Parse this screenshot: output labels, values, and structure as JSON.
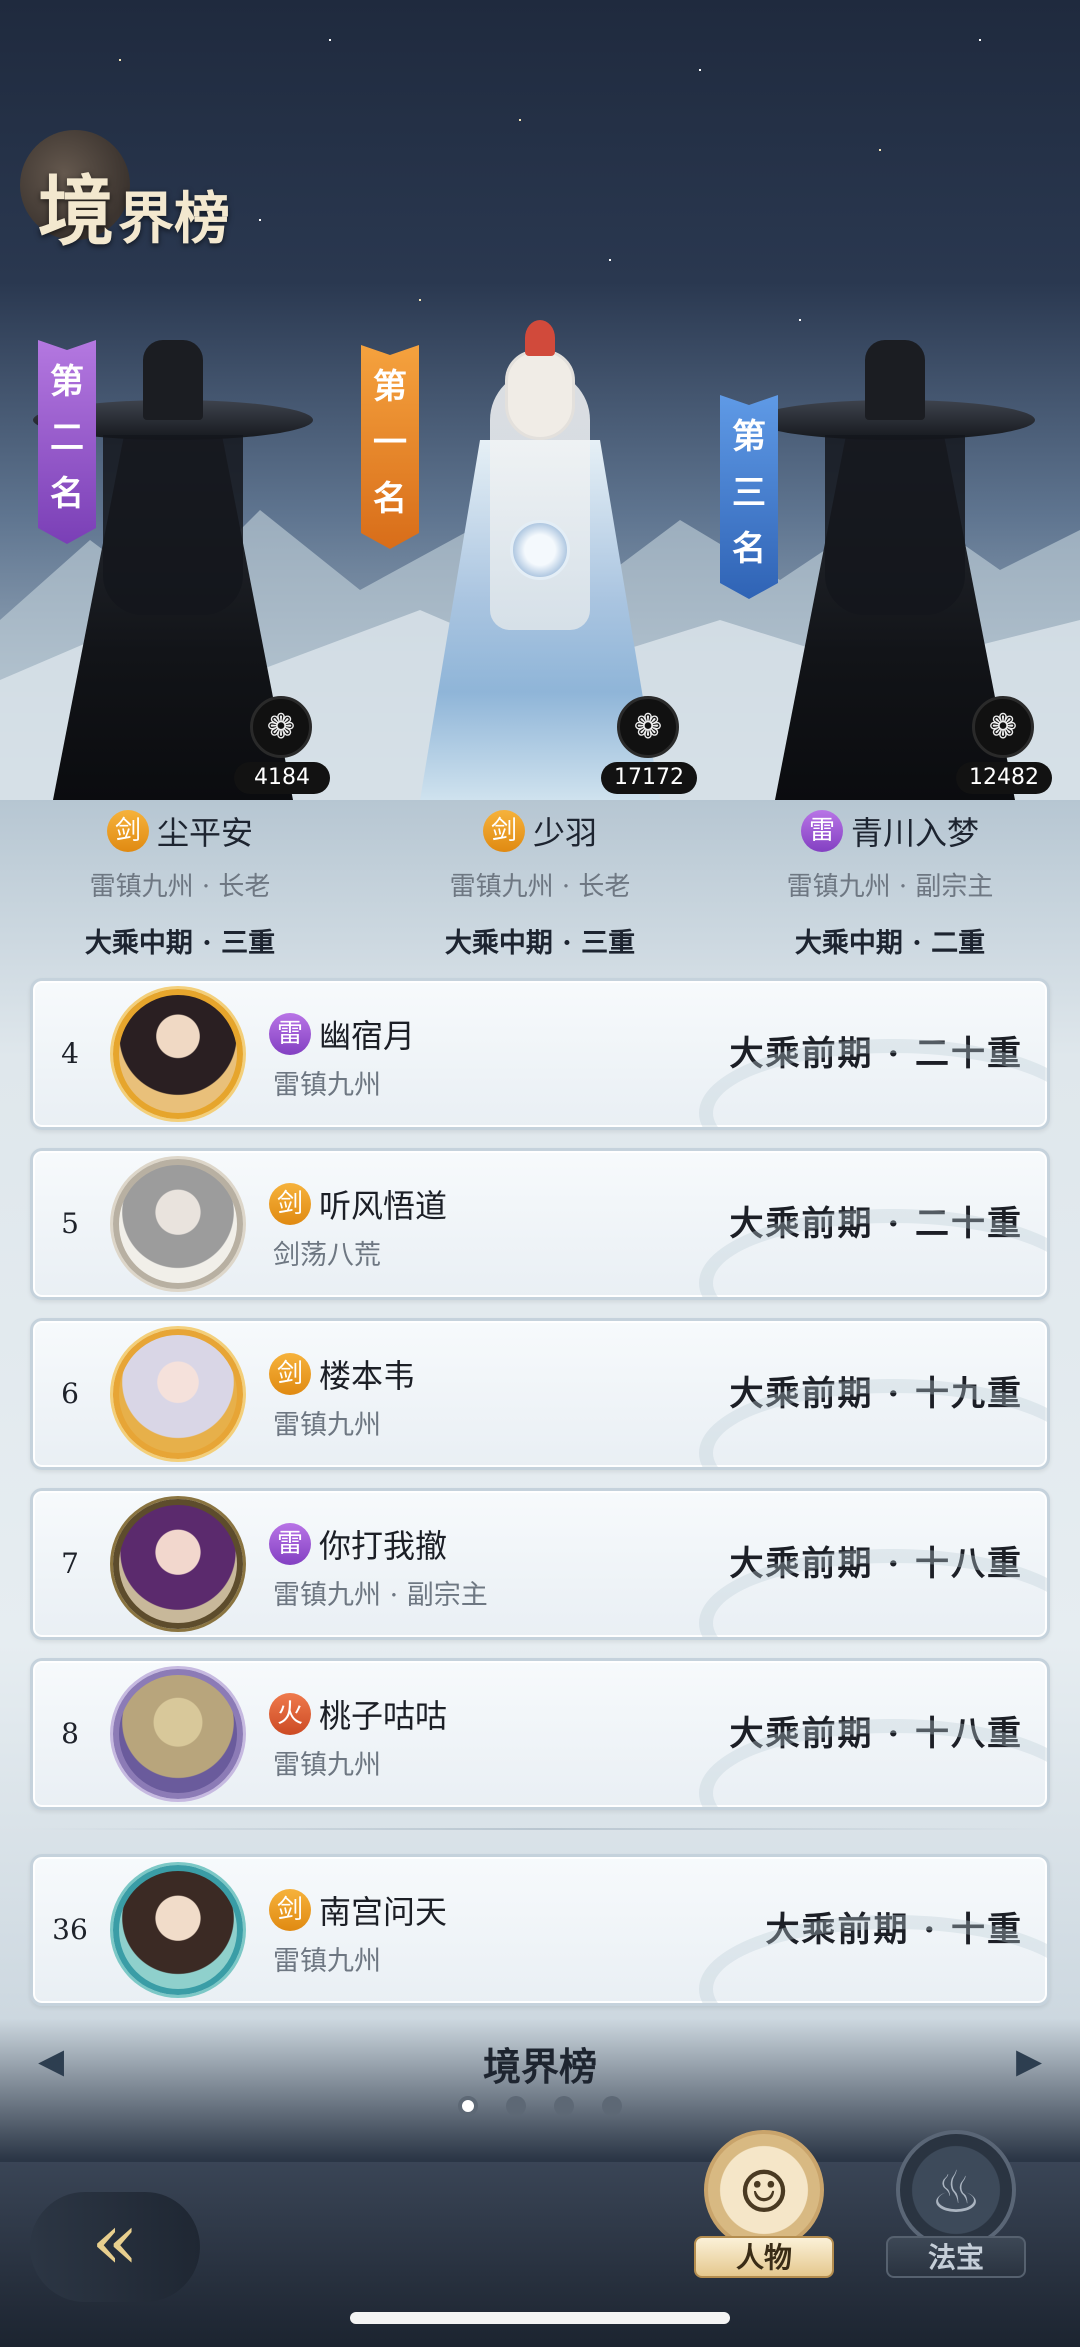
{
  "header": {
    "title_big": "境",
    "title_small": "界榜"
  },
  "podium": [
    {
      "rank_label": [
        "第",
        "二",
        "名"
      ],
      "badge": "剑",
      "badge_type": "sword",
      "name": "尘平安",
      "sect": "雷镇九州 · 长老",
      "realm": "大乘中期 · 三重",
      "likes": "4184"
    },
    {
      "rank_label": [
        "第",
        "一",
        "名"
      ],
      "badge": "剑",
      "badge_type": "sword",
      "name": "少羽",
      "sect": "雷镇九州 · 长老",
      "realm": "大乘中期 · 三重",
      "likes": "17172"
    },
    {
      "rank_label": [
        "第",
        "三",
        "名"
      ],
      "badge": "雷",
      "badge_type": "thunder",
      "name": "青川入梦",
      "sect": "雷镇九州 · 副宗主",
      "realm": "大乘中期 · 二重",
      "likes": "12482"
    }
  ],
  "ranking_list": [
    {
      "rank": "4",
      "badge": "雷",
      "badge_type": "thunder",
      "name": "幽宿月",
      "sect": "雷镇九州",
      "realm": "大乘前期 · 二十重"
    },
    {
      "rank": "5",
      "badge": "剑",
      "badge_type": "sword",
      "name": "听风悟道",
      "sect": "剑荡八荒",
      "realm": "大乘前期 · 二十重"
    },
    {
      "rank": "6",
      "badge": "剑",
      "badge_type": "sword",
      "name": "楼本韦",
      "sect": "雷镇九州",
      "realm": "大乘前期 · 十九重"
    },
    {
      "rank": "7",
      "badge": "雷",
      "badge_type": "thunder",
      "name": "你打我撤",
      "sect": "雷镇九州 · 副宗主",
      "realm": "大乘前期 · 十八重"
    },
    {
      "rank": "8",
      "badge": "火",
      "badge_type": "fire",
      "name": "桃子咕咕",
      "sect": "雷镇九州",
      "realm": "大乘前期 · 十八重"
    }
  ],
  "my_rank": {
    "rank": "36",
    "badge": "剑",
    "badge_type": "sword",
    "name": "南宫问天",
    "sect": "雷镇九州",
    "realm": "大乘前期 · 十重"
  },
  "pager": {
    "label": "境界榜",
    "page_count": 4,
    "current": 1
  },
  "bottom_tabs": [
    {
      "label": "人物",
      "icon": "portrait-icon",
      "active": true
    },
    {
      "label": "法宝",
      "icon": "gourd-icon",
      "active": false
    }
  ],
  "colors": {
    "sword": "#f0a22a",
    "thunder": "#9a58d2",
    "fire": "#dc5c33",
    "rank1": "#e9882a",
    "rank2": "#9a5ccc",
    "rank3": "#4a82d4"
  }
}
